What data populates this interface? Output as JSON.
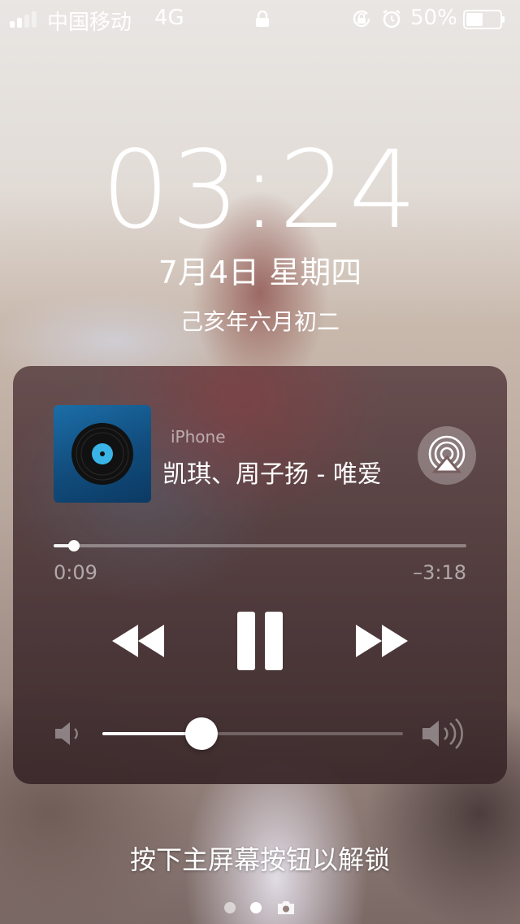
{
  "status_bar": {
    "carrier": "中国移动",
    "network": "4G",
    "battery_percent": "50%",
    "battery_level": 0.5,
    "signal_bars": 2,
    "icons": [
      "signal-icon",
      "lock-icon",
      "rotation-lock-icon",
      "alarm-icon",
      "battery-icon"
    ]
  },
  "lock_screen": {
    "time": "03:24",
    "date": "7月4日 星期四",
    "lunar_date": "己亥年六月初二",
    "unlock_hint": "按下主屏幕按钮以解锁",
    "page_count": 2,
    "active_page": 1
  },
  "now_playing": {
    "source": "iPhone",
    "track": "凯琪、周子扬 - 唯爱",
    "elapsed": "0:09",
    "remaining": "–3:18",
    "progress": 0.05,
    "volume": 0.33,
    "icons": [
      "album-art",
      "airplay-icon",
      "rewind-icon",
      "pause-icon",
      "fast-forward-icon",
      "volume-low-icon",
      "volume-high-icon"
    ]
  },
  "colors": {
    "art_blue": "#1b6ea8",
    "disc_label": "#3ab4e6",
    "panel": "#5a3e40"
  }
}
